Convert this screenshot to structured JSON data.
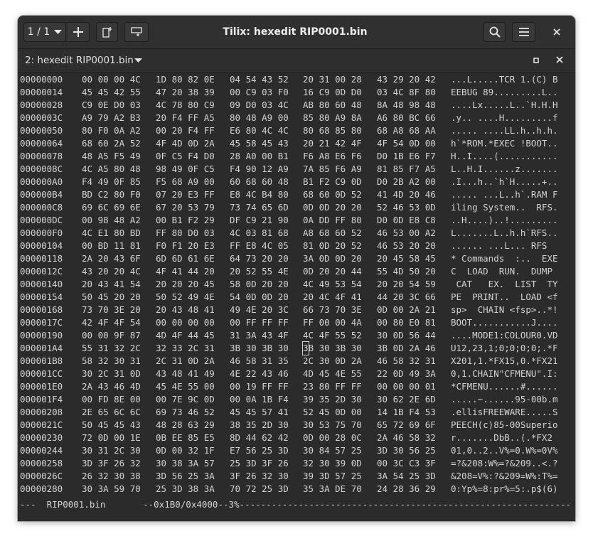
{
  "window": {
    "title": "Tilix: hexedit RIP0001.bin",
    "session_label": "1 / 1"
  },
  "tab": {
    "title": "2: hexedit RIP0001.bin"
  },
  "icons": [
    "chevron-down-icon",
    "add-icon",
    "split-right-icon",
    "split-down-icon",
    "search-icon",
    "hamburger-menu-icon",
    "close-icon",
    "maximize-icon"
  ],
  "hexedit": {
    "rows": [
      {
        "offset": "00000000",
        "hex": [
          "00 00 00 4C",
          "1D 80 82 0E",
          "04 54 43 52",
          "20 31 00 28",
          "43 29 20 42"
        ],
        "ascii": "...L.....TCR 1.(C) B"
      },
      {
        "offset": "00000014",
        "hex": [
          "45 45 42 55",
          "47 20 38 39",
          "00 C9 03 F0",
          "16 C9 0D D0",
          "03 4C 8F 80"
        ],
        "ascii": "EEBUG 89.........L.."
      },
      {
        "offset": "00000028",
        "hex": [
          "C9 0E D0 03",
          "4C 78 80 C9",
          "09 D0 03 4C",
          "AB 80 60 48",
          "8A 48 98 48"
        ],
        "ascii": "....Lx.....L..`H.H.H"
      },
      {
        "offset": "0000003C",
        "hex": [
          "A9 79 A2 B3",
          "20 F4 FF A5",
          "80 48 A9 00",
          "85 80 A9 8A",
          "A6 80 BC 66"
        ],
        "ascii": ".y.. ....H.........f"
      },
      {
        "offset": "00000050",
        "hex": [
          "80 F0 0A A2",
          "00 20 F4 FF",
          "E6 80 4C 4C",
          "80 68 85 80",
          "68 A8 68 AA"
        ],
        "ascii": "..... ....LL.h..h.h."
      },
      {
        "offset": "00000064",
        "hex": [
          "68 60 2A 52",
          "4F 4D 0D 2A",
          "45 58 45 43",
          "20 21 42 4F",
          "4F 54 0D 00"
        ],
        "ascii": "h`*ROM.*EXEC !BOOT.."
      },
      {
        "offset": "00000078",
        "hex": [
          "48 A5 F5 49",
          "0F C5 F4 D0",
          "28 A0 00 B1",
          "F6 A8 E6 F6",
          "D0 1B E6 F7"
        ],
        "ascii": "H..I....(..........."
      },
      {
        "offset": "0000008C",
        "hex": [
          "4C A5 80 48",
          "98 49 0F C5",
          "F4 90 12 A9",
          "7A 85 F6 A9",
          "81 85 F7 A5"
        ],
        "ascii": "L..H.I......z......."
      },
      {
        "offset": "000000A0",
        "hex": [
          "F4 49 0F 85",
          "F5 68 A9 00",
          "60 68 60 48",
          "B1 F2 C9 0D",
          "D0 2B A2 00"
        ],
        "ascii": ".I...h..`h`H.....+.."
      },
      {
        "offset": "000000B4",
        "hex": [
          "BD C2 80 F0",
          "07 20 E3 FF",
          "E8 4C B4 80",
          "68 60 0D 52",
          "41 4D 20 46"
        ],
        "ascii": "..... ...L..h`.RAM F"
      },
      {
        "offset": "000000C8",
        "hex": [
          "69 6C 69 6E",
          "67 20 53 79",
          "73 74 65 6D",
          "0D 0D 20 20",
          "52 46 53 0D"
        ],
        "ascii": "iling System..  RFS."
      },
      {
        "offset": "000000DC",
        "hex": [
          "00 98 48 A2",
          "00 B1 F2 29",
          "DF C9 21 90",
          "0A DD FF 80",
          "D0 0D E8 C8"
        ],
        "ascii": "..H....)..!........."
      },
      {
        "offset": "000000F0",
        "hex": [
          "4C E1 80 BD",
          "FF 80 D0 03",
          "4C 03 81 68",
          "A8 68 60 52",
          "46 53 00 A2"
        ],
        "ascii": "L.......L..h.h`RFS.."
      },
      {
        "offset": "00000104",
        "hex": [
          "00 BD 11 81",
          "F0 F1 20 E3",
          "FF E8 4C 05",
          "81 0D 20 52",
          "46 53 20 20"
        ],
        "ascii": "...... ...L... RFS  "
      },
      {
        "offset": "00000118",
        "hex": [
          "2A 20 43 6F",
          "6D 6D 61 6E",
          "64 73 20 20",
          "3A 0D 0D 20",
          "20 45 58 45"
        ],
        "ascii": "* Commands  :..  EXE"
      },
      {
        "offset": "0000012C",
        "hex": [
          "43 20 20 4C",
          "4F 41 44 20",
          "20 52 55 4E",
          "0D 20 20 44",
          "55 4D 50 20"
        ],
        "ascii": "C  LOAD  RUN.  DUMP "
      },
      {
        "offset": "00000140",
        "hex": [
          "20 43 41 54",
          "20 20 20 45",
          "58 0D 20 20",
          "4C 49 53 54",
          "20 20 54 59"
        ],
        "ascii": " CAT   EX.  LIST  TY"
      },
      {
        "offset": "00000154",
        "hex": [
          "50 45 20 20",
          "50 52 49 4E",
          "54 0D 0D 20",
          "20 4C 4F 41",
          "44 20 3C 66"
        ],
        "ascii": "PE  PRINT..  LOAD <f"
      },
      {
        "offset": "00000168",
        "hex": [
          "73 70 3E 20",
          "20 43 48 41",
          "49 4E 20 3C",
          "66 73 70 3E",
          "0D 00 2A 21"
        ],
        "ascii": "sp>  CHAIN <fsp>..*!"
      },
      {
        "offset": "0000017C",
        "hex": [
          "42 4F 4F 54",
          "00 00 00 00",
          "00 FF FF FF",
          "FF 00 00 4A",
          "00 80 E0 81"
        ],
        "ascii": "BOOT...........J...."
      },
      {
        "offset": "00000190",
        "hex": [
          "00 00 9F 87",
          "4D 4F 44 45",
          "31 3A 43 4F",
          "4C 4F 55 52",
          "30 0D 56 44"
        ],
        "ascii": "....MODE1:COLOUR0.VD"
      },
      {
        "offset": "000001A4",
        "hex": [
          "55 31 32 2C",
          "32 33 2C 31",
          "3B 30 3B 30",
          "3B 30 3B 30",
          "3B 0D 2A 46"
        ],
        "ascii": "U12,23,1;0;0;0;0;.*F"
      },
      {
        "offset": "000001B8",
        "hex": [
          "58 32 30 31",
          "2C 31 0D 2A",
          "46 58 31 35",
          "2C 30 0D 2A",
          "46 58 32 31"
        ],
        "ascii": "X201,1.*FX15,0.*FX21"
      },
      {
        "offset": "000001CC",
        "hex": [
          "30 2C 31 0D",
          "43 48 41 49",
          "4E 22 43 46",
          "4D 45 4E 55",
          "22 0D 49 3A"
        ],
        "ascii": "0,1.CHAIN\"CFMENU\".I:"
      },
      {
        "offset": "000001E0",
        "hex": [
          "2A 43 46 4D",
          "45 4E 55 00",
          "00 19 FF FF",
          "23 80 FF FF",
          "00 00 00 01"
        ],
        "ascii": "*CFMENU......#......"
      },
      {
        "offset": "000001F4",
        "hex": [
          "00 FD 8E 00",
          "00 7E 9C 0D",
          "00 0A 1B F4",
          "39 35 2D 30",
          "30 62 2E 6D"
        ],
        "ascii": ".....~......95-00b.m"
      },
      {
        "offset": "00000208",
        "hex": [
          "2E 65 6C 6C",
          "69 73 46 52",
          "45 45 57 41",
          "52 45 0D 00",
          "14 1B F4 53"
        ],
        "ascii": ".ellisFREEWARE.....S"
      },
      {
        "offset": "0000021C",
        "hex": [
          "50 45 45 43",
          "48 28 63 29",
          "38 35 2D 30",
          "30 53 75 70",
          "65 72 69 6F"
        ],
        "ascii": "PEECH(c)85-00Superio"
      },
      {
        "offset": "00000230",
        "hex": [
          "72 0D 00 1E",
          "0B EE 85 E5",
          "8D 44 62 42",
          "0D 00 28 0C",
          "2A 46 58 32"
        ],
        "ascii": "r.......DbB..(.*FX2"
      },
      {
        "offset": "00000244",
        "hex": [
          "30 31 2C 30",
          "0D 00 32 1F",
          "E7 56 25 3D",
          "30 84 57 25",
          "3D 30 56 25"
        ],
        "ascii": "01,0..2..V%=0.W%=0V%"
      },
      {
        "offset": "00000258",
        "hex": [
          "3D 3F 26 32",
          "30 38 3A 57",
          "25 3D 3F 26",
          "32 30 39 0D",
          "00 3C C3 3F"
        ],
        "ascii": "=?&208:W%=?&209..<.?"
      },
      {
        "offset": "0000026C",
        "hex": [
          "26 32 30 38",
          "3D 56 25 3A",
          "3F 26 32 30",
          "39 3D 57 25",
          "3A 54 25 3D"
        ],
        "ascii": "&208=V%:?&209=W%:T%="
      },
      {
        "offset": "00000280",
        "hex": [
          "30 3A 59 70",
          "25 3D 38 3A",
          "70 72 25 3D",
          "35 3A DE 70",
          "24 28 36 29"
        ],
        "ascii": "0:Yp%=8:pr%=5:.p$(6)"
      }
    ],
    "cursor_row": 21,
    "cursor_group": 3,
    "status_line": "---  RIP0001.bin       --0x1B0/0x4000--3%------------------------------------------------------------------------"
  }
}
